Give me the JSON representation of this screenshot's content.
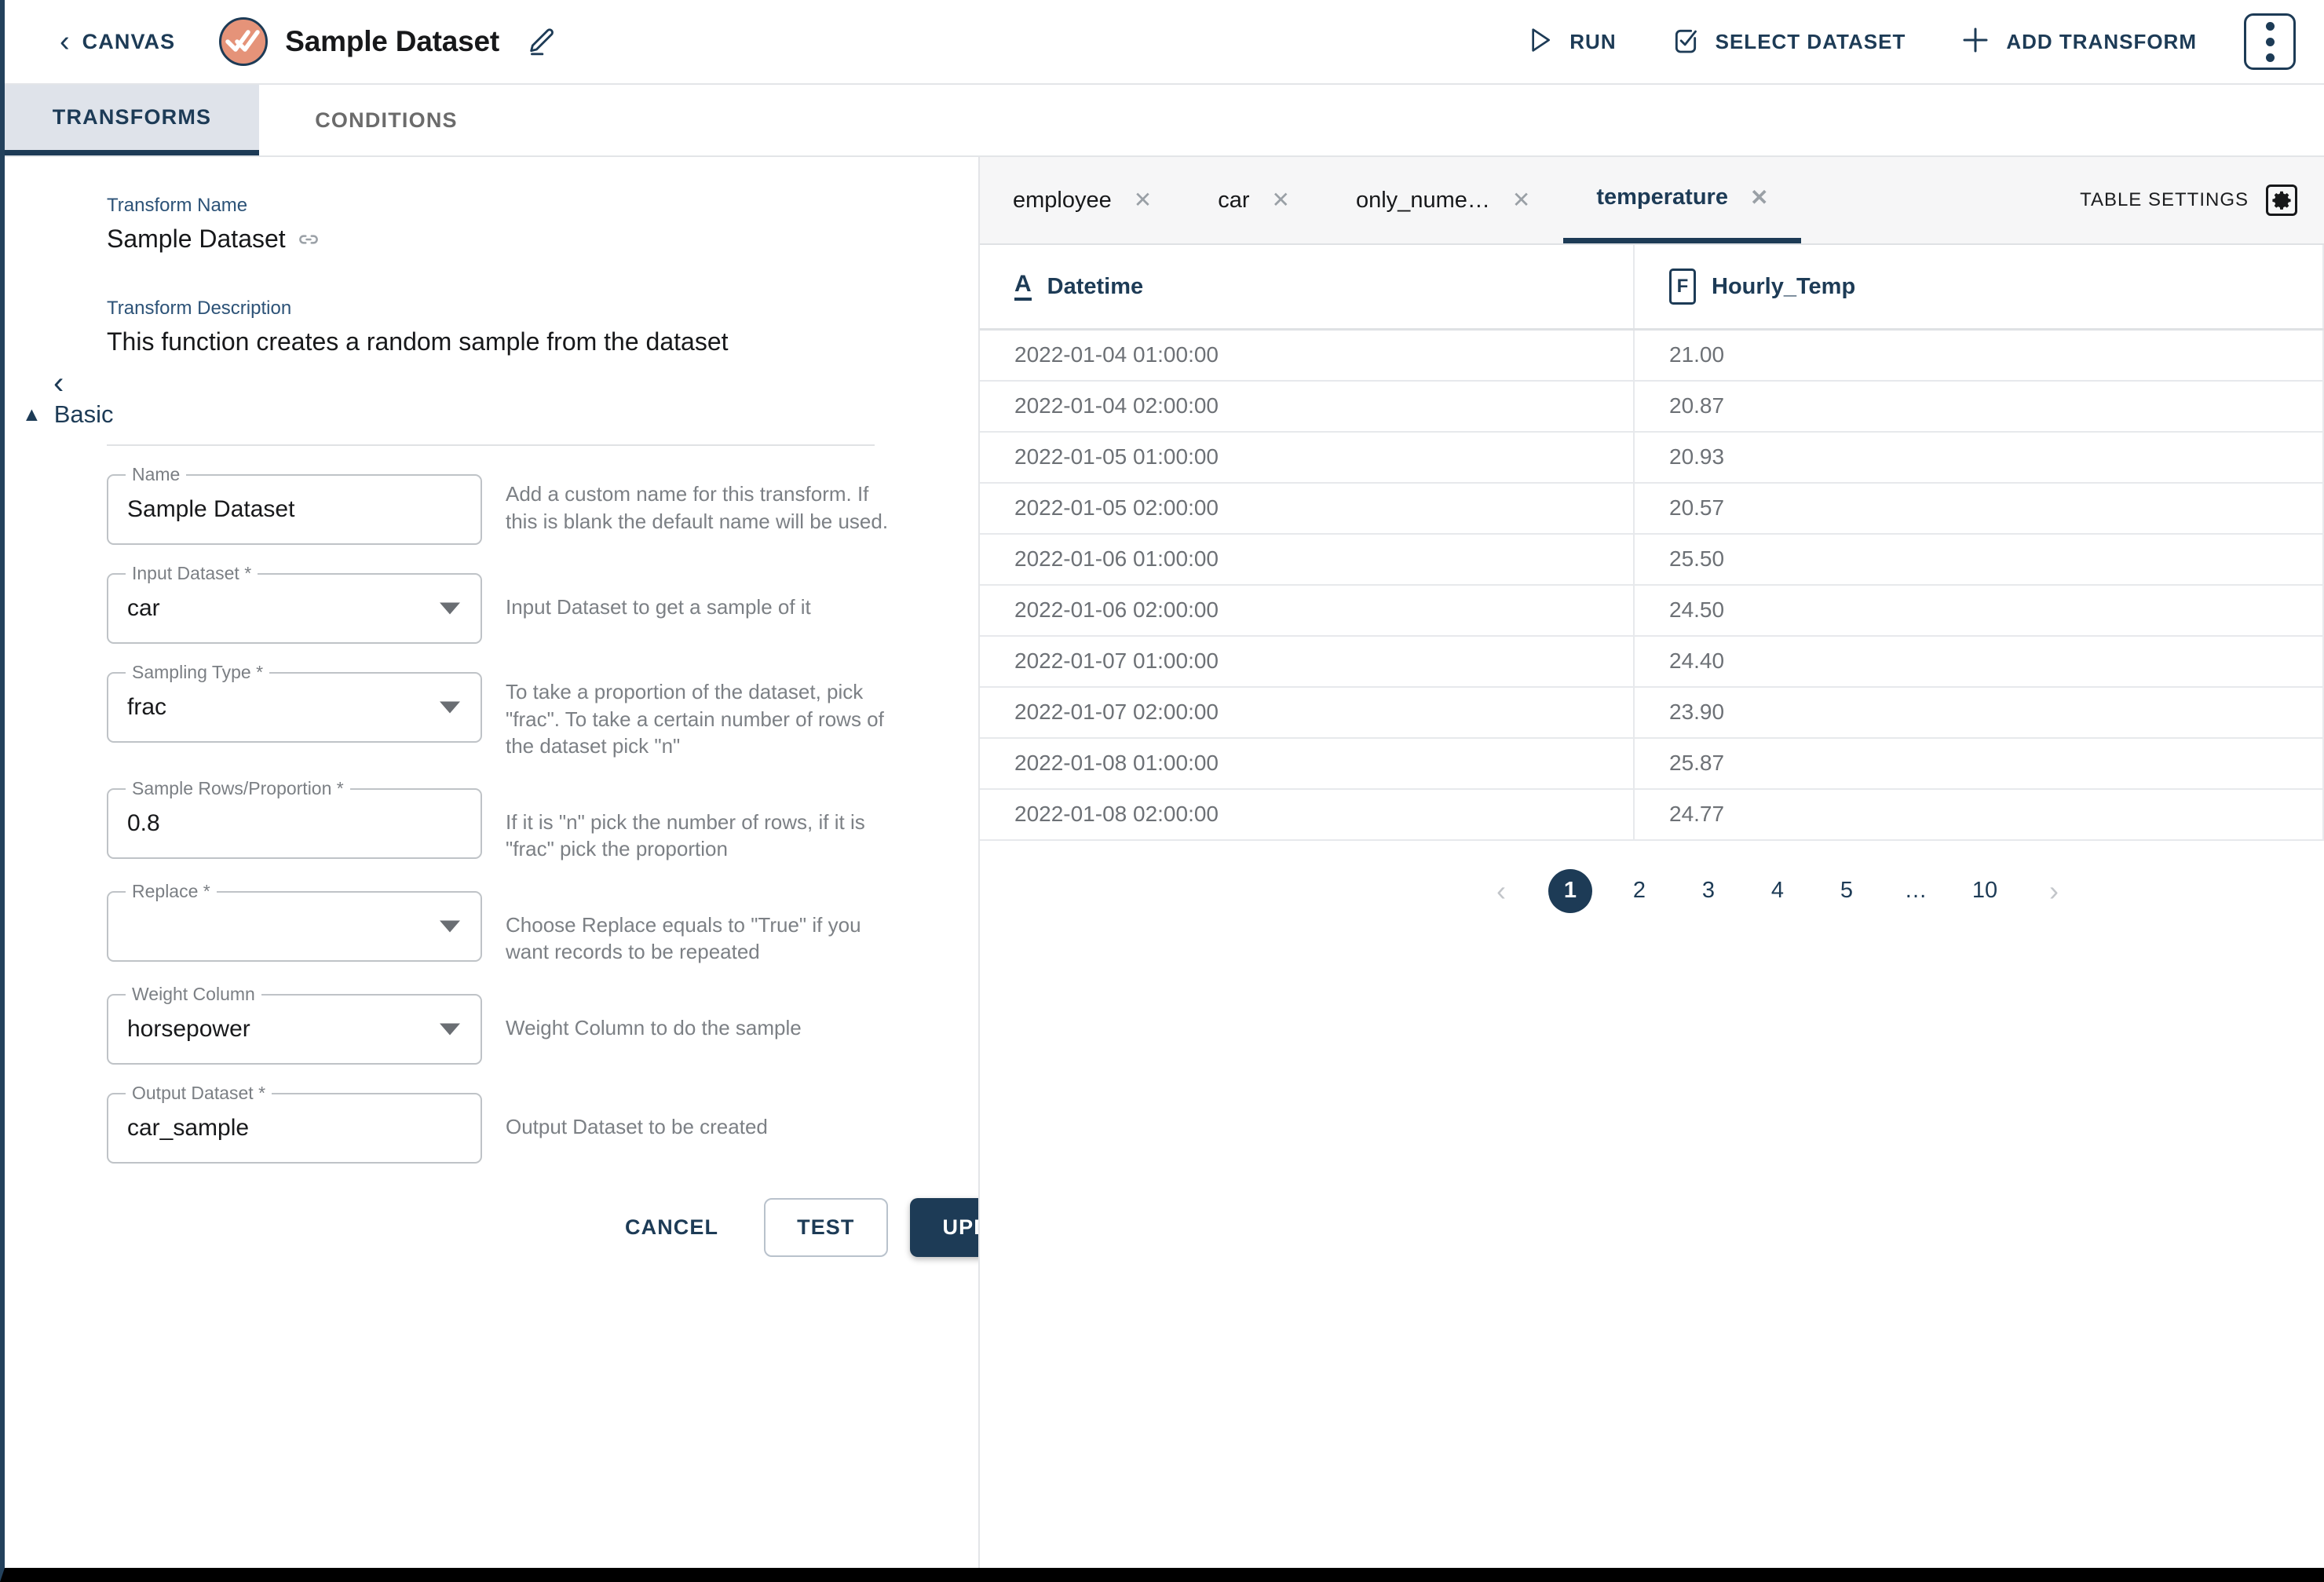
{
  "header": {
    "back_label": "CANVAS",
    "app_title": "Sample Dataset",
    "logo_color": "#e59379",
    "accent_color": "#1d3b56",
    "actions": [
      {
        "label": "RUN",
        "icon": "play-icon"
      },
      {
        "label": "SELECT DATASET",
        "icon": "checkbox-check-icon"
      },
      {
        "label": "ADD TRANSFORM",
        "icon": "plus-icon"
      }
    ],
    "overflow_icon": "kebab-menu-icon",
    "edit_icon": "pencil-icon"
  },
  "main_tabs": [
    {
      "label": "TRANSFORMS",
      "active": true
    },
    {
      "label": "CONDITIONS",
      "active": false
    }
  ],
  "transform": {
    "name_caption": "Transform Name",
    "name_value": "Sample Dataset",
    "link_icon": "link-icon",
    "description_caption": "Transform Description",
    "description_value": "This function creates a random sample from the dataset",
    "section_label": "Basic",
    "section_caret": "collapse-caret-up-icon"
  },
  "fields": [
    {
      "label": "Name",
      "value": "Sample Dataset",
      "type": "text",
      "hint": "Add a custom name for this transform. If this is blank the default name will be used."
    },
    {
      "label": "Input Dataset *",
      "value": "car",
      "type": "select",
      "hint": "Input Dataset to get a sample of it"
    },
    {
      "label": "Sampling Type *",
      "value": "frac",
      "type": "select",
      "hint": "To take a proportion of the dataset, pick \"frac\". To take a certain number of rows of the dataset pick \"n\""
    },
    {
      "label": "Sample Rows/Proportion *",
      "value": "0.8",
      "type": "text",
      "hint": "If it is \"n\" pick the number of rows, if it is \"frac\" pick the proportion"
    },
    {
      "label": "Replace *",
      "value": "",
      "type": "select",
      "hint": "Choose Replace equals to \"True\" if you want records to be repeated"
    },
    {
      "label": "Weight Column",
      "value": "horsepower",
      "type": "select",
      "hint": "Weight Column to do the sample"
    },
    {
      "label": "Output Dataset *",
      "value": "car_sample",
      "type": "text",
      "hint": "Output Dataset to be created"
    }
  ],
  "form_actions": {
    "cancel": "CANCEL",
    "test": "TEST",
    "update": "UPDATE"
  },
  "dataset_tabs": [
    {
      "label": "employee",
      "active": false
    },
    {
      "label": "car",
      "active": false
    },
    {
      "label": "only_nume…",
      "active": false
    },
    {
      "label": "temperature",
      "active": true
    }
  ],
  "table_settings": {
    "label": "TABLE SETTINGS",
    "icon": "gear-icon"
  },
  "table": {
    "columns": [
      {
        "name": "Datetime",
        "type_icon": "A"
      },
      {
        "name": "Hourly_Temp",
        "type_icon": "F"
      }
    ],
    "rows": [
      [
        "2022-01-04 01:00:00",
        "21.00"
      ],
      [
        "2022-01-04 02:00:00",
        "20.87"
      ],
      [
        "2022-01-05 01:00:00",
        "20.93"
      ],
      [
        "2022-01-05 02:00:00",
        "20.57"
      ],
      [
        "2022-01-06 01:00:00",
        "25.50"
      ],
      [
        "2022-01-06 02:00:00",
        "24.50"
      ],
      [
        "2022-01-07 01:00:00",
        "24.40"
      ],
      [
        "2022-01-07 02:00:00",
        "23.90"
      ],
      [
        "2022-01-08 01:00:00",
        "25.87"
      ],
      [
        "2022-01-08 02:00:00",
        "24.77"
      ]
    ]
  },
  "pagination": {
    "prev": "‹",
    "next": "›",
    "pages": [
      "1",
      "2",
      "3",
      "4",
      "5",
      "…",
      "10"
    ],
    "current": "1"
  }
}
